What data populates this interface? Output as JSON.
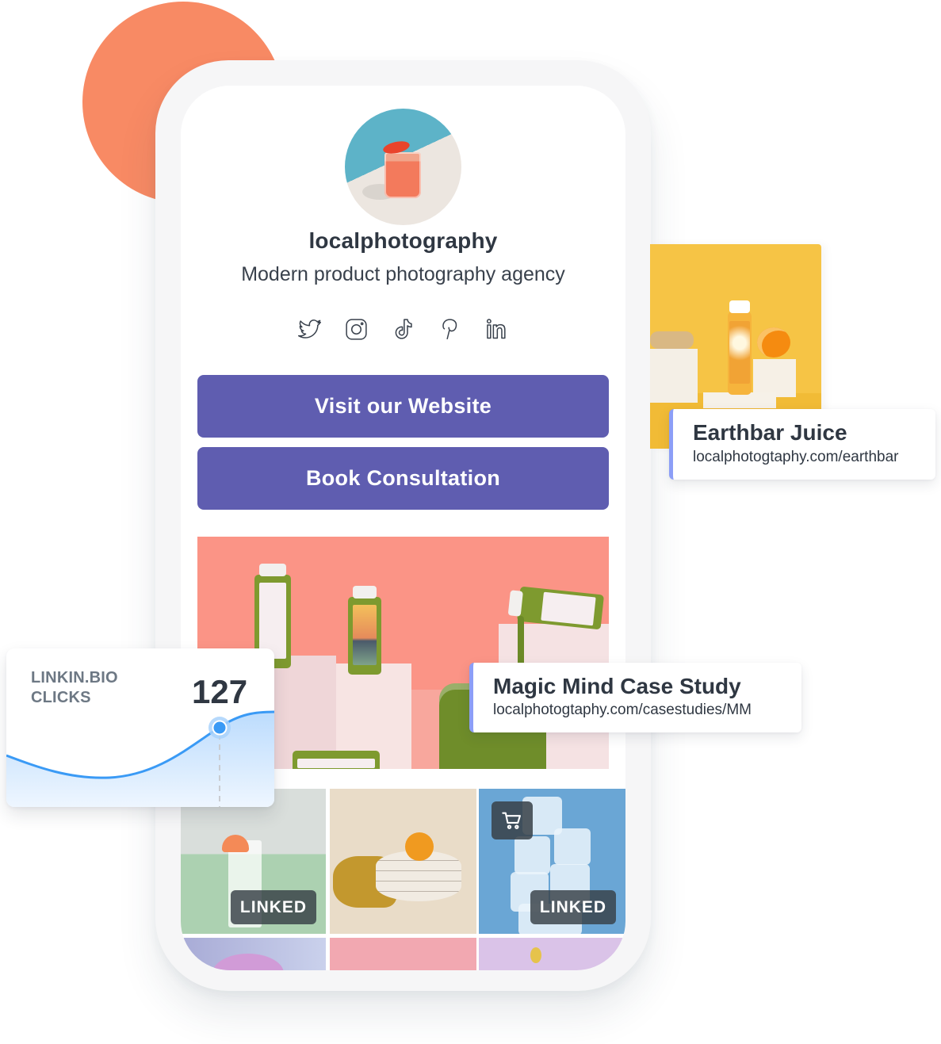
{
  "profile": {
    "username": "localphotography",
    "tagline": "Modern product photography agency",
    "avatar": "profile-photo-drink"
  },
  "socials": [
    {
      "name": "twitter",
      "icon": "twitter-icon"
    },
    {
      "name": "instagram",
      "icon": "instagram-icon"
    },
    {
      "name": "tiktok",
      "icon": "tiktok-icon"
    },
    {
      "name": "pinterest",
      "icon": "pinterest-icon"
    },
    {
      "name": "linkedin",
      "icon": "linkedin-icon"
    }
  ],
  "buttons": {
    "visit_website": "Visit our Website",
    "book_consultation": "Book Consultation"
  },
  "grid": {
    "tiles": [
      {
        "subject": "cocktail",
        "badge": "LINKED"
      },
      {
        "subject": "plates-mandarin",
        "badge": ""
      },
      {
        "subject": "ice-cubes",
        "badge": "LINKED",
        "icon": "shopping-cart-icon"
      },
      {
        "subject": "pink-cloud",
        "badge": ""
      },
      {
        "subject": "pink-background",
        "badge": ""
      },
      {
        "subject": "flower",
        "badge": ""
      }
    ]
  },
  "link_cards": {
    "earthbar": {
      "title": "Earthbar Juice",
      "url": "localphotogtaphy.com/earthbar"
    },
    "magic_mind": {
      "title": "Magic Mind Case Study",
      "url": "localphotogtaphy.com/casestudies/MM"
    }
  },
  "clicks_widget": {
    "label_line1": "LINKIN.BIO",
    "label_line2": "CLICKS",
    "value": "127"
  },
  "colors": {
    "button": "#5f5db0",
    "accent_bar": "#8c9ef7",
    "chart_line": "#3a9af5",
    "blob": "#f88a64",
    "text_dark": "#2f3742"
  }
}
